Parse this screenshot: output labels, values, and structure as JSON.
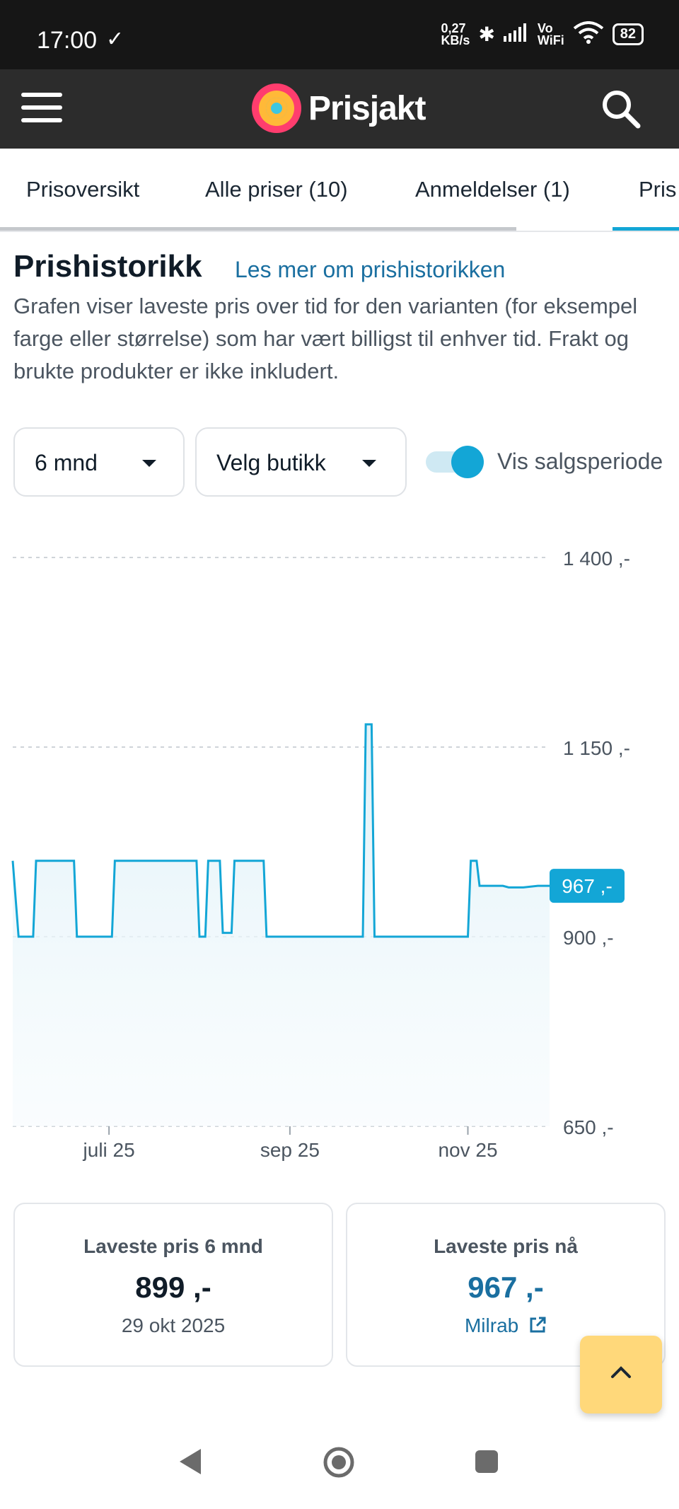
{
  "status": {
    "time": "17:00",
    "net_speed_top": "0,27",
    "net_speed_bottom": "KB/s",
    "volte_top": "Vo",
    "volte_bottom": "WiFi",
    "battery": "82"
  },
  "app": {
    "brand": "Prisjakt"
  },
  "tabs": [
    {
      "label": "Prisoversikt"
    },
    {
      "label": "Alle priser (10)"
    },
    {
      "label": "Anmeldelser (1)"
    },
    {
      "label": "Pris"
    }
  ],
  "section": {
    "title": "Prishistorikk",
    "read_more": "Les mer om prishistorikken",
    "description": "Grafen viser laveste pris over tid for den varianten (for eksempel farge eller størrelse) som har vært billigst til enhver tid. Frakt og brukte produkter er ikke inkludert."
  },
  "filters": {
    "period": "6 mnd",
    "store": "Velg butikk",
    "toggle_label": "Vis salgsperiode",
    "toggle_on": true
  },
  "chart_data": {
    "type": "line",
    "title": "",
    "xlabel": "",
    "ylabel": "",
    "ylim": [
      650,
      1400
    ],
    "y_ticks": [
      "1 400 ,-",
      "1 150 ,-",
      "900 ,-",
      "650 ,-"
    ],
    "y_tick_values": [
      1400,
      1150,
      900,
      650
    ],
    "x_ticks": [
      "juli 25",
      "sep 25",
      "nov 25"
    ],
    "x_tick_days": [
      33,
      95,
      156
    ],
    "x": [
      0,
      2,
      7,
      8,
      21,
      22,
      34,
      35,
      63,
      64,
      66,
      67,
      71,
      72,
      75,
      76,
      86,
      87,
      120,
      121,
      123,
      124,
      156,
      157,
      159,
      160,
      168,
      170,
      175,
      180,
      184
    ],
    "y": [
      1000,
      900,
      900,
      1000,
      1000,
      900,
      900,
      1000,
      1000,
      900,
      900,
      1000,
      1000,
      905,
      905,
      1000,
      1000,
      900,
      900,
      1180,
      1180,
      900,
      900,
      1000,
      1000,
      967,
      967,
      965,
      965,
      967,
      967
    ],
    "current_label": "967 ,-",
    "grid": true,
    "accent": "#13a6d6"
  },
  "cards": {
    "lowest_period": {
      "title": "Laveste pris 6 mnd",
      "value": "899 ,-",
      "date": "29 okt 2025"
    },
    "lowest_now": {
      "title": "Laveste pris nå",
      "value": "967 ,-",
      "store": "Milrab"
    }
  },
  "colors": {
    "link": "#1a6fa0",
    "accent": "#13a6d6",
    "fab": "#ffd87a"
  }
}
